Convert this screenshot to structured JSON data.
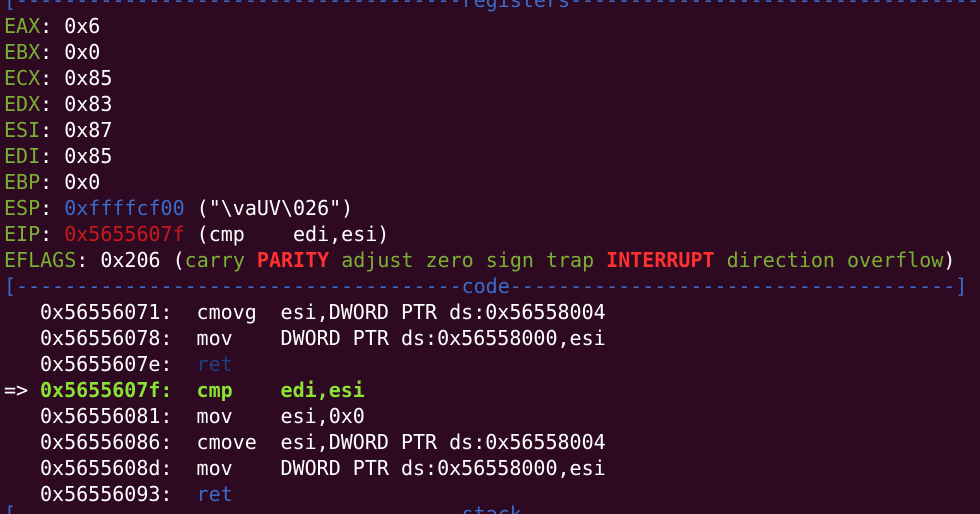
{
  "registers_title": "registers",
  "code_title": "code",
  "stack_title": "stack",
  "registers": [
    {
      "name": "EAX",
      "value": "0x6"
    },
    {
      "name": "EBX",
      "value": "0x0"
    },
    {
      "name": "ECX",
      "value": "0x85"
    },
    {
      "name": "EDX",
      "value": "0x83"
    },
    {
      "name": "ESI",
      "value": "0x87"
    },
    {
      "name": "EDI",
      "value": "0x85"
    },
    {
      "name": "EBP",
      "value": "0x0"
    },
    {
      "name": "ESP",
      "value": "0xffffcf00",
      "extra": " (\"\\vaUV\\026\")"
    },
    {
      "name": "EIP",
      "value": "0x5655607f",
      "extra": " (cmp    edi,esi)"
    }
  ],
  "eflags": {
    "name": "EFLAGS",
    "value": "0x206",
    "flags": [
      {
        "name": "carry",
        "set": false
      },
      {
        "name": "PARITY",
        "set": true
      },
      {
        "name": "adjust",
        "set": false
      },
      {
        "name": "zero",
        "set": false
      },
      {
        "name": "sign",
        "set": false
      },
      {
        "name": "trap",
        "set": false
      },
      {
        "name": "INTERRUPT",
        "set": true
      },
      {
        "name": "direction",
        "set": false
      },
      {
        "name": "overflow",
        "set": false
      }
    ]
  },
  "code": [
    {
      "arrow": "",
      "addr": "0x56556071:",
      "mnemonic": "cmovg",
      "operands": "esi,DWORD PTR ds:0x56558004",
      "current": false
    },
    {
      "arrow": "",
      "addr": "0x56556078:",
      "mnemonic": "mov",
      "operands": "DWORD PTR ds:0x56558000,esi",
      "current": false
    },
    {
      "arrow": "",
      "addr": "0x5655607e:",
      "mnemonic": "ret",
      "operands": "",
      "current": false,
      "style": "dark"
    },
    {
      "arrow": "=>",
      "addr": "0x5655607f:",
      "mnemonic": "cmp",
      "operands": "edi,esi",
      "current": true
    },
    {
      "arrow": "",
      "addr": "0x56556081:",
      "mnemonic": "mov",
      "operands": "esi,0x0",
      "current": false
    },
    {
      "arrow": "",
      "addr": "0x56556086:",
      "mnemonic": "cmove",
      "operands": "esi,DWORD PTR ds:0x56558004",
      "current": false
    },
    {
      "arrow": "",
      "addr": "0x5655608d:",
      "mnemonic": "mov",
      "operands": "DWORD PTR ds:0x56558000,esi",
      "current": false
    },
    {
      "arrow": "",
      "addr": "0x56556093:",
      "mnemonic": "ret",
      "operands": "",
      "current": false,
      "style": "dim"
    }
  ],
  "colors": {
    "background": "#2d0a22",
    "register_name": "#7bb033",
    "separator": "#3b6bc9",
    "flag_set": "#ff3030",
    "current_instruction": "#8ae234",
    "eip_value": "#c71a1a"
  }
}
